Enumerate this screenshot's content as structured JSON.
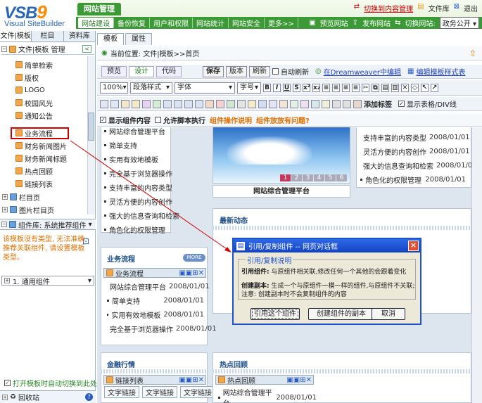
{
  "header": {
    "logo_main": "VSB",
    "logo_nine": "9",
    "logo_sub": "Visual SiteBuilder",
    "site_tab": "网站管理",
    "top_links": [
      "切换到内容管理",
      "文件库",
      "退出"
    ],
    "nav_items": [
      "网站建设",
      "备份恢复",
      "用户和权限",
      "网站统计",
      "网站安全",
      "更多>>"
    ],
    "nav_right": [
      "预览网站",
      "发布网站",
      "切换网站:"
    ],
    "site_select": "政务公开"
  },
  "left": {
    "tabs": [
      "文件|模板",
      "栏目",
      "资料库"
    ],
    "root_label": "文件|模板 管理",
    "tree_items": [
      "简单检索",
      "版权",
      "LOGO",
      "校园风光",
      "通知公告",
      "业务流程",
      "财务新闻图片",
      "财务新闻标题",
      "热点回顾",
      "链接列表"
    ],
    "tree_groups": [
      "栏目页",
      "图片栏目页"
    ],
    "component_lib": "组件库: 系统推荐组件",
    "warning": "该模板没有类型, 无法准确推荐关联组件, 请设置模板类型。",
    "component_row": "1. 通用组件",
    "auto_switch": "打开模板时自动切换到此处",
    "recycle": "回收站"
  },
  "main": {
    "tabs": [
      "模板",
      "属性"
    ],
    "breadcrumb": "当前位置: 文件|模板>>首页",
    "view_tabs": [
      "预览",
      "设计",
      "代码"
    ],
    "buttons": [
      "保存",
      "版本",
      "刷新"
    ],
    "auto_refresh": "自动刷新",
    "dreamweaver": "在Dreamweaver中编辑",
    "edit_style": "编辑模板样式表",
    "zoom": "100%",
    "para_style": "段落样式",
    "font": "字体",
    "font_size": "字号",
    "add_label": "添加标签",
    "show_table": "显示表格/DIV线",
    "show_components": "显示组件内容",
    "allow_scripts": "允许脚本执行",
    "op_help": "组件操作说明",
    "question": "组件放放有问题?"
  },
  "canvas": {
    "list_top": [
      "网站综合管理平台",
      "简单支持",
      "实用有效地模板",
      "完全基于浏览器操作",
      "支持丰富的内容类型",
      "灵活方便的内容创作",
      "强大的信息查询和检索",
      "角色化的权限管理"
    ],
    "banner_caption": "网站综合管理平台",
    "banner_pages": [
      "1",
      "2",
      "3",
      "4",
      "5",
      "6"
    ],
    "right_list": [
      {
        "title": "支持丰富的内容类型",
        "date": "2008/01/01"
      },
      {
        "title": "灵活方便的内容创作",
        "date": "2008/01/01"
      },
      {
        "title": "强大的信息查询和检索",
        "date": "2008/01/01"
      },
      {
        "title": "角色化的权限管理",
        "date": "2008/01/01"
      }
    ],
    "latest_news": "最新动态",
    "process_title": "业务流程",
    "process_header": "业务流程",
    "process_list": [
      {
        "title": "网站综合管理平台",
        "date": "2008/01/01"
      },
      {
        "title": "简单支持",
        "date": "2008/01/01"
      },
      {
        "title": "实用有效地模板",
        "date": "2008/01/01"
      },
      {
        "title": "完全基于浏览器操作",
        "date": "2008/01/01"
      }
    ],
    "more": "MORE",
    "finance_title": "金融行情",
    "link_list": "链接列表",
    "text_links": [
      "文字链接",
      "文字链接",
      "文字链接"
    ],
    "hot_review": "热点回顾",
    "hot_header": "热点回顾",
    "hot_item": {
      "title": "网站综合管理平台",
      "date": "2008/01/01"
    }
  },
  "dialog": {
    "title": "引用/复制组件 -- 网页对话框",
    "legend": "引用/复制说明",
    "ref_label": "引用组件:",
    "ref_text": "与原组件相关联,修改任何一个其他的会跟着变化",
    "copy_label": "创建副本:",
    "copy_text": "生成一个与原组件一模一样的组件,与原组件不关联;",
    "note": "注意: 创建副本时不会复制组件的内容",
    "buttons": [
      "引用这个组件",
      "创建组件的副本",
      "取消"
    ]
  }
}
